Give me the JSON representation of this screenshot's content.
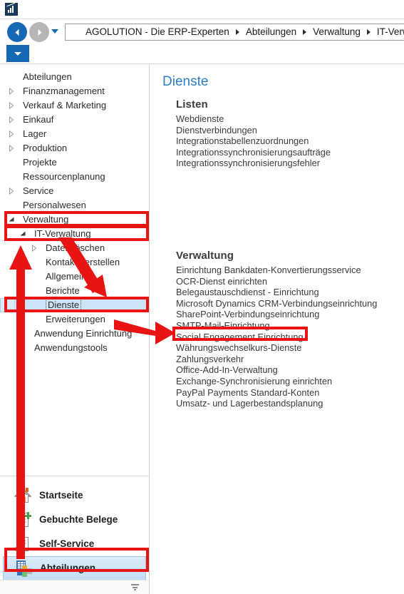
{
  "window": {
    "app_icon": "chart-app-icon"
  },
  "navigation": {
    "back_icon": "back-arrow-icon",
    "forward_icon": "forward-arrow-icon",
    "history_dropdown_icon": "chevron-down-icon",
    "breadcrumb": [
      "AGOLUTION - Die ERP-Experten",
      "Abteilungen",
      "Verwaltung",
      "IT-Verwaltung"
    ]
  },
  "ribbon": {
    "dropdown_icon": "chevron-down-icon"
  },
  "sidebar": {
    "tree": [
      {
        "label": "Abteilungen",
        "indent": 0,
        "expander": "none",
        "selected": false
      },
      {
        "label": "Finanzmanagement",
        "indent": 0,
        "expander": "collapsed",
        "selected": false
      },
      {
        "label": "Verkauf & Marketing",
        "indent": 0,
        "expander": "collapsed",
        "selected": false
      },
      {
        "label": "Einkauf",
        "indent": 0,
        "expander": "collapsed",
        "selected": false
      },
      {
        "label": "Lager",
        "indent": 0,
        "expander": "collapsed",
        "selected": false
      },
      {
        "label": "Produktion",
        "indent": 0,
        "expander": "collapsed",
        "selected": false
      },
      {
        "label": "Projekte",
        "indent": 0,
        "expander": "none",
        "selected": false
      },
      {
        "label": "Ressourcenplanung",
        "indent": 0,
        "expander": "none",
        "selected": false
      },
      {
        "label": "Service",
        "indent": 0,
        "expander": "collapsed",
        "selected": false
      },
      {
        "label": "Personalwesen",
        "indent": 0,
        "expander": "none",
        "selected": false
      },
      {
        "label": "Verwaltung",
        "indent": 0,
        "expander": "expanded",
        "selected": false
      },
      {
        "label": "IT-Verwaltung",
        "indent": 1,
        "expander": "expanded",
        "selected": false
      },
      {
        "label": "Daten löschen",
        "indent": 2,
        "expander": "collapsed",
        "selected": false
      },
      {
        "label": "Kontakte erstellen",
        "indent": 2,
        "expander": "none",
        "selected": false
      },
      {
        "label": "Allgemein",
        "indent": 2,
        "expander": "none",
        "selected": false
      },
      {
        "label": "Berichte",
        "indent": 2,
        "expander": "none",
        "selected": false
      },
      {
        "label": "Dienste",
        "indent": 2,
        "expander": "none",
        "selected": true
      },
      {
        "label": "Erweiterungen",
        "indent": 2,
        "expander": "none",
        "selected": false
      },
      {
        "label": "Anwendung Einrichtung",
        "indent": 1,
        "expander": "collapsed",
        "selected": false
      },
      {
        "label": "Anwendungstools",
        "indent": 1,
        "expander": "none",
        "selected": false
      }
    ],
    "bottom_nav": [
      {
        "label": "Startseite",
        "icon": "home-icon",
        "selected": false
      },
      {
        "label": "Gebuchte Belege",
        "icon": "document-add-icon",
        "selected": false
      },
      {
        "label": "Self-Service",
        "icon": "people-document-icon",
        "selected": false
      },
      {
        "label": "Abteilungen",
        "icon": "departments-grid-icon",
        "selected": true
      }
    ],
    "footer_icon": "collapse-panel-icon"
  },
  "main": {
    "title": "Dienste",
    "groups": [
      {
        "heading": "Listen",
        "items": [
          "Webdienste",
          "Dienstverbindungen",
          "Integrationstabellenzuordnungen",
          "Integrationssynchronisierungsaufträge",
          "Integrationssynchronisierungsfehler"
        ]
      },
      {
        "heading": "Verwaltung",
        "items": [
          "Einrichtung Bankdaten-Konvertierungsservice",
          "OCR-Dienst einrichten",
          "Belegaustauschdienst - Einrichtung",
          "Microsoft Dynamics CRM-Verbindungseinrichtung",
          "SharePoint-Verbindungseinrichtung",
          "SMTP-Mail-Einrichtung",
          "Social Engagement Einrichtung",
          "Währungswechselkurs-Dienste",
          "Zahlungsverkehr",
          "Office-Add-In-Verwaltung",
          "Exchange-Synchronisierung einrichten",
          "PayPal Payments Standard-Konten",
          "Umsatz- und Lagerbestandsplanung"
        ]
      }
    ]
  },
  "annotations": {
    "highlight_color": "#e81313",
    "boxes": [
      {
        "name": "highlight-verwaltung",
        "target": "Verwaltung"
      },
      {
        "name": "highlight-it-verwaltung",
        "target": "IT-Verwaltung"
      },
      {
        "name": "highlight-dienste",
        "target": "Dienste"
      },
      {
        "name": "highlight-paypal",
        "target": "PayPal Payments Standard-Konten"
      },
      {
        "name": "highlight-abteilungen",
        "target": "Abteilungen"
      }
    ],
    "arrows": [
      {
        "name": "arrow-up-to-tree",
        "direction": "up"
      },
      {
        "name": "arrow-down-to-dienste",
        "direction": "down-right"
      },
      {
        "name": "arrow-right-to-paypal",
        "direction": "right"
      }
    ]
  },
  "colors": {
    "accent": "#1569b4",
    "title_blue": "#2c7fc4",
    "selection": "#cde3f7",
    "annotation_red": "#e81313"
  }
}
